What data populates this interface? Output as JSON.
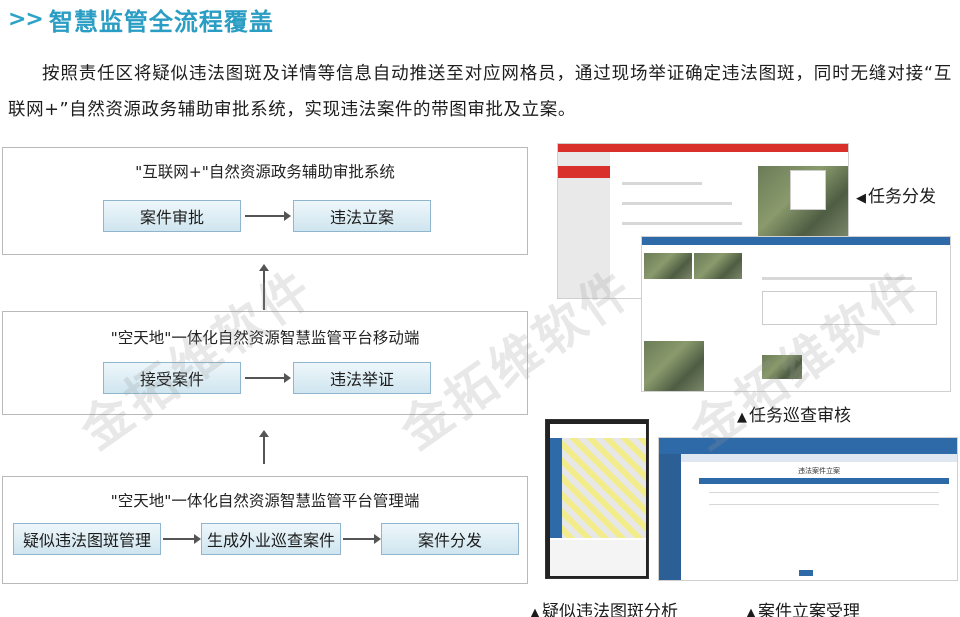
{
  "header": {
    "chevrons": ">>",
    "title": "智慧监管全流程覆盖"
  },
  "intro": "按照责任区将疑似违法图斑及详情等信息自动推送至对应网格员，通过现场举证确定违法图斑，同时无缝对接“互联网+”自然资源政务辅助审批系统，实现违法案件的带图审批及立案。",
  "flow": {
    "top": {
      "title": "\"互联网+\"自然资源政务辅助审批系统",
      "box1": "案件审批",
      "box2": "违法立案"
    },
    "middle": {
      "title": "\"空天地\"一体化自然资源智慧监管平台移动端",
      "box1": "接受案件",
      "box2": "违法举证"
    },
    "bottom": {
      "title": "\"空天地\"一体化自然资源智慧监管平台管理端",
      "box1": "疑似违法图斑管理",
      "box2": "生成外业巡查案件",
      "box3": "案件分发"
    }
  },
  "captions": {
    "task_dispatch": "任务分发",
    "task_patrol": "任务巡查审核",
    "suspected_analysis": "疑似违法图斑分析",
    "case_filing": "案件立案受理"
  },
  "case_filing_window": {
    "form_title": "违法案件立案"
  },
  "watermark": "金拓维软件"
}
